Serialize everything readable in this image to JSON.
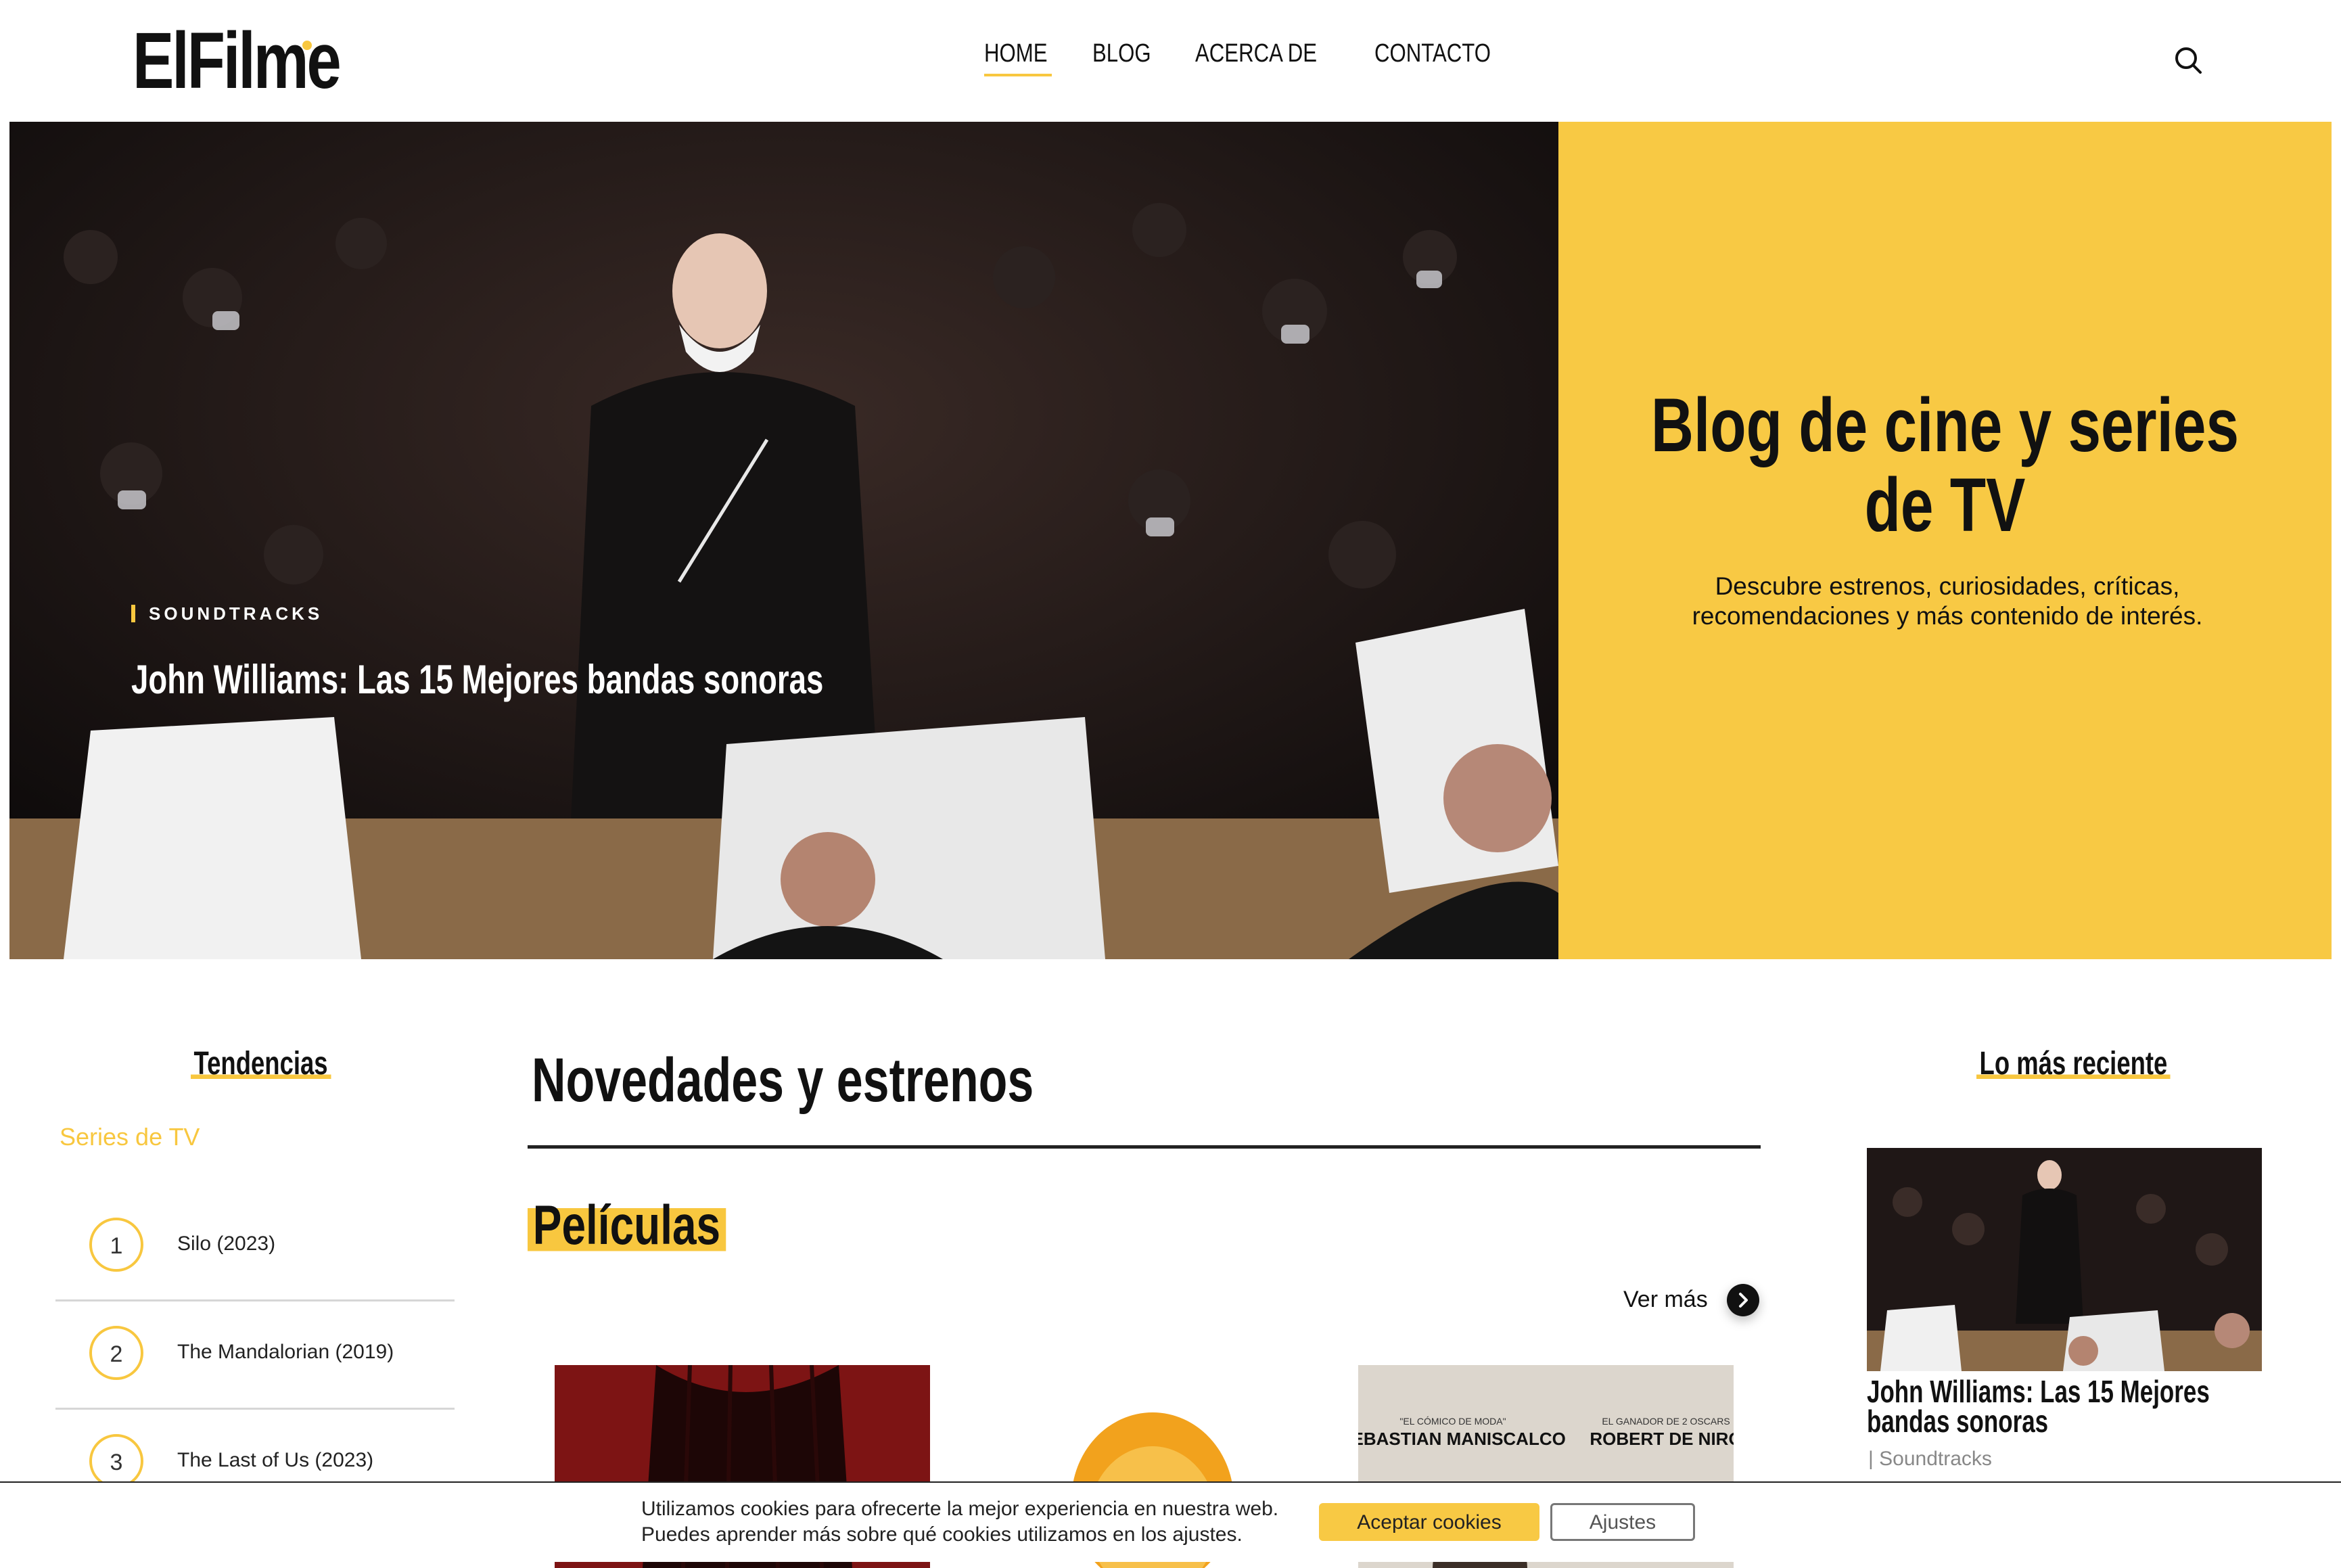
{
  "header": {
    "logo": "ElFilme",
    "nav": [
      "HOME",
      "BLOG",
      "ACERCA DE",
      "CONTACTO"
    ],
    "active_nav": "HOME"
  },
  "hero": {
    "category": "SOUNDTRACKS",
    "title": "John Williams: Las 15 Mejores bandas sonoras",
    "slide_count": 4,
    "active_slide": 1
  },
  "panel": {
    "title": "Blog de cine y series de TV",
    "subtitle": "Descubre estrenos, curiosidades, críticas, recomendaciones y más contenido de interés."
  },
  "tendencias": {
    "heading": "Tendencias",
    "category": "Series de TV",
    "items": [
      {
        "num": "1",
        "name": "Silo (2023)"
      },
      {
        "num": "2",
        "name": "The Mandalorian (2019)"
      },
      {
        "num": "3",
        "name": "The Last of Us (2023)"
      }
    ]
  },
  "main": {
    "heading": "Novedades y estrenos",
    "section": "Películas",
    "more": "Ver más",
    "poster_texts": {
      "actor1_tag": "\"EL CÓMICO DE MODA\"",
      "actor1": "SEBASTIAN MANISCALCO",
      "actor2_tag": "EL GANADOR DE 2 OSCARS",
      "actor2": "ROBERT DE NIRO"
    }
  },
  "recent": {
    "heading": "Lo más reciente",
    "title": "John Williams: Las 15 Mejores bandas sonoras",
    "category": "Soundtracks"
  },
  "cookie": {
    "line1": "Utilizamos cookies para ofrecerte la mejor experiencia en nuestra web.",
    "line2": "Puedes aprender más sobre qué cookies utilizamos en los ajustes.",
    "accept": "Aceptar cookies",
    "settings": "Ajustes"
  },
  "colors": {
    "accent": "#f8c944",
    "text": "#111111"
  }
}
